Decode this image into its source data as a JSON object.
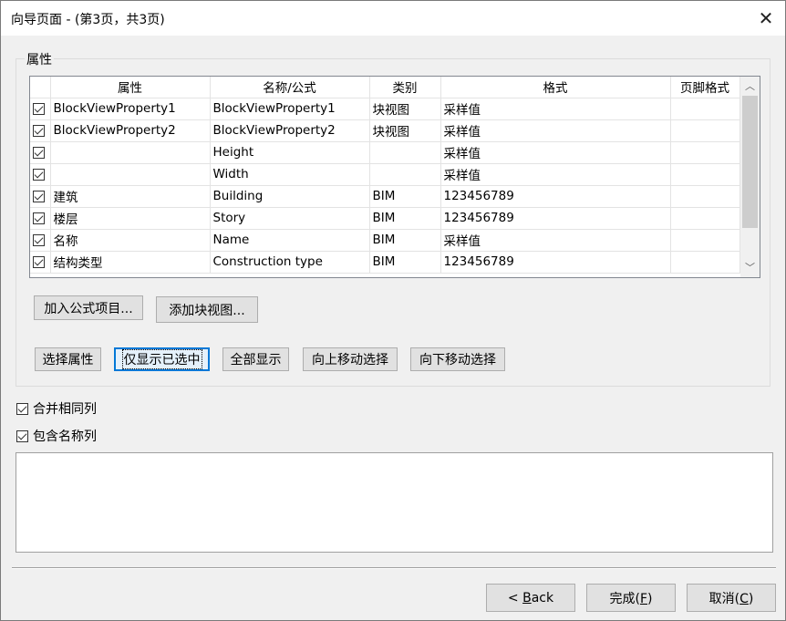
{
  "window": {
    "title": "向导页面 - (第3页，共3页)"
  },
  "group": {
    "label": "属性"
  },
  "table": {
    "headers": [
      "属性",
      "名称/公式",
      "类别",
      "格式",
      "页脚格式"
    ],
    "rows": [
      {
        "checked": true,
        "property": "BlockViewProperty1",
        "name": "BlockViewProperty1",
        "category": "块视图",
        "format": "采样值",
        "footer": ""
      },
      {
        "checked": true,
        "property": "BlockViewProperty2",
        "name": "BlockViewProperty2",
        "category": "块视图",
        "format": "采样值",
        "footer": ""
      },
      {
        "checked": true,
        "property": "",
        "name": "Height",
        "category": "",
        "format": "采样值",
        "footer": ""
      },
      {
        "checked": true,
        "property": "",
        "name": "Width",
        "category": "",
        "format": "采样值",
        "footer": ""
      },
      {
        "checked": true,
        "property": "建筑",
        "name": "Building",
        "category": "BIM",
        "format": "123456789",
        "footer": ""
      },
      {
        "checked": true,
        "property": "楼层",
        "name": "Story",
        "category": "BIM",
        "format": "123456789",
        "footer": ""
      },
      {
        "checked": true,
        "property": "名称",
        "name": "Name",
        "category": "BIM",
        "format": "采样值",
        "footer": ""
      },
      {
        "checked": true,
        "property": "结构类型",
        "name": "Construction type",
        "category": "BIM",
        "format": "123456789",
        "footer": ""
      }
    ]
  },
  "buttons": {
    "add_formula": "加入公式项目...",
    "add_blockview": "添加块视图...",
    "select_props": "选择属性",
    "show_selected": "仅显示已选中",
    "show_all": "全部显示",
    "move_up": "向上移动选择",
    "move_down": "向下移动选择"
  },
  "options": {
    "merge_columns": {
      "label": "合并相同列",
      "checked": true
    },
    "include_name": {
      "label": "包含名称列",
      "checked": true
    }
  },
  "footer": {
    "back_prefix": "< ",
    "back_key": "B",
    "back_rest": "ack",
    "finish_prefix": "完成(",
    "finish_key": "F",
    "finish_suffix": ")",
    "cancel_prefix": "取消(",
    "cancel_key": "C",
    "cancel_suffix": ")"
  },
  "icons": {
    "close": "close-icon",
    "scroll_up": "chevron-up-icon",
    "scroll_down": "chevron-down-icon",
    "check": "checkmark-icon"
  }
}
